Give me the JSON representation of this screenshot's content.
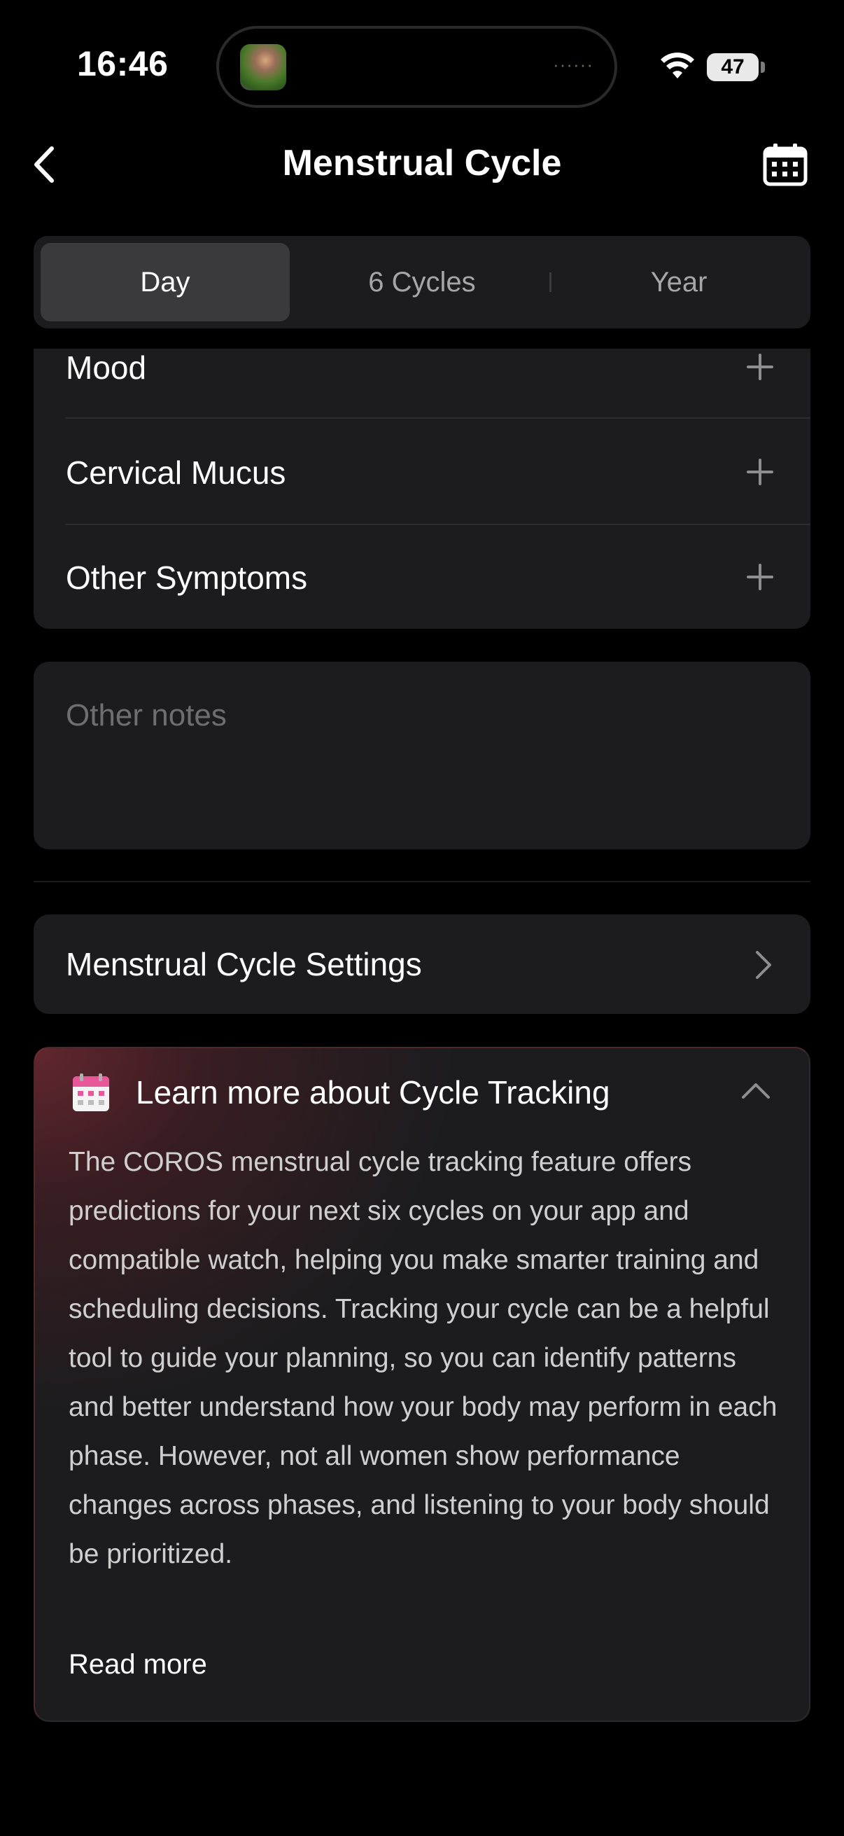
{
  "status_bar": {
    "time": "16:46",
    "battery": "47",
    "island_dots": "······"
  },
  "header": {
    "title": "Menstrual Cycle",
    "back_icon": "chevron-left-icon",
    "calendar_icon": "calendar-icon"
  },
  "tabs": [
    {
      "label": "Day",
      "active": true
    },
    {
      "label": "6 Cycles",
      "active": false
    },
    {
      "label": "Year",
      "active": false
    }
  ],
  "symptoms": [
    {
      "label": "Mood",
      "icon": "plus-icon"
    },
    {
      "label": "Cervical Mucus",
      "icon": "plus-icon"
    },
    {
      "label": "Other Symptoms",
      "icon": "plus-icon"
    }
  ],
  "notes": {
    "placeholder": "Other notes"
  },
  "settings": {
    "label": "Menstrual Cycle Settings"
  },
  "learn_more": {
    "title": "Learn more about Cycle Tracking",
    "body": "The COROS menstrual cycle tracking feature offers predictions for your next six cycles on your app and compatible watch, helping you make smarter training and scheduling decisions. Tracking your cycle can be a helpful tool to guide your planning, so you can identify patterns and better understand how your body may perform in each phase. However, not all women show performance changes across phases, and listening to your body should be prioritized.",
    "read_more": "Read more"
  },
  "colors": {
    "background": "#000000",
    "card": "#1c1c1e",
    "active_tab": "#3a3a3c",
    "placeholder": "#6e6e6e",
    "accent_pink": "#e8579a"
  }
}
